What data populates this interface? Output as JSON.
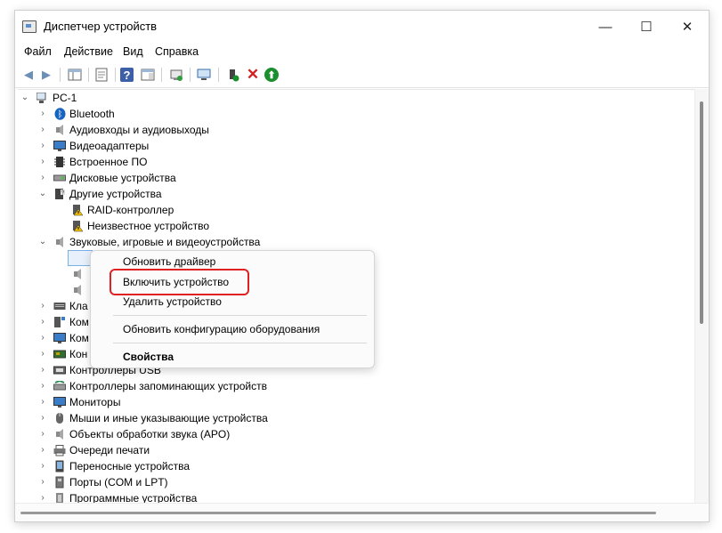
{
  "window": {
    "title": "Диспетчер устройств",
    "minimize": "—",
    "maximize": "☐",
    "close": "✕"
  },
  "menu": [
    "Файл",
    "Действие",
    "Вид",
    "Справка"
  ],
  "tree": {
    "root": "PC-1",
    "items": [
      {
        "label": "Bluetooth",
        "icon": "bluetooth-icon",
        "chev": "›"
      },
      {
        "label": "Аудиовходы и аудиовыходы",
        "icon": "speaker-icon",
        "chev": "›"
      },
      {
        "label": "Видеоадаптеры",
        "icon": "monitor-icon",
        "chev": "›"
      },
      {
        "label": "Встроенное ПО",
        "icon": "chip-icon",
        "chev": "›"
      },
      {
        "label": "Дисковые устройства",
        "icon": "disk-icon",
        "chev": "›"
      },
      {
        "label": "Другие устройства",
        "icon": "unknown-device-icon",
        "chev": "⌄"
      },
      {
        "label": "RAID-контроллер",
        "icon": "warning-device-icon",
        "chev": ""
      },
      {
        "label": "Неизвестное устройство",
        "icon": "warning-device-icon",
        "chev": ""
      },
      {
        "label": "Звуковые, игровые и видеоустройства",
        "icon": "speaker-icon",
        "chev": "⌄"
      },
      {
        "label": "",
        "icon": "disabled-speaker-icon",
        "chev": ""
      },
      {
        "label": "",
        "icon": "speaker-icon",
        "chev": ""
      },
      {
        "label": "",
        "icon": "speaker-icon",
        "chev": ""
      },
      {
        "label": "Кла",
        "icon": "keyboard-icon",
        "chev": "›"
      },
      {
        "label": "Ком",
        "icon": "computer-icon",
        "chev": "›"
      },
      {
        "label": "Ком",
        "icon": "monitor-icon",
        "chev": "›"
      },
      {
        "label": "Кон",
        "icon": "controller-icon",
        "chev": "›"
      },
      {
        "label": "Контроллеры USB",
        "icon": "usb-icon",
        "chev": "›"
      },
      {
        "label": "Контроллеры запоминающих устройств",
        "icon": "storage-controller-icon",
        "chev": "›"
      },
      {
        "label": "Мониторы",
        "icon": "monitor-icon",
        "chev": "›"
      },
      {
        "label": "Мыши и иные указывающие устройства",
        "icon": "mouse-icon",
        "chev": "›"
      },
      {
        "label": "Объекты обработки звука (APO)",
        "icon": "speaker-icon",
        "chev": "›"
      },
      {
        "label": "Очереди печати",
        "icon": "printer-icon",
        "chev": "›"
      },
      {
        "label": "Переносные устройства",
        "icon": "portable-device-icon",
        "chev": "›"
      },
      {
        "label": "Порты (COM и LPT)",
        "icon": "port-icon",
        "chev": "›"
      },
      {
        "label": "Программные устройства",
        "icon": "software-device-icon",
        "chev": "›"
      }
    ]
  },
  "context_menu": {
    "update_driver": "Обновить драйвер",
    "enable_device": "Включить устройство",
    "uninstall_device": "Удалить устройство",
    "scan_hardware": "Обновить конфигурацию оборудования",
    "properties": "Свойства"
  },
  "colors": {
    "highlight": "#e12121",
    "bluetooth": "#1565c0",
    "enable_green": "#1a8f2e",
    "remove_red": "#d32020"
  }
}
